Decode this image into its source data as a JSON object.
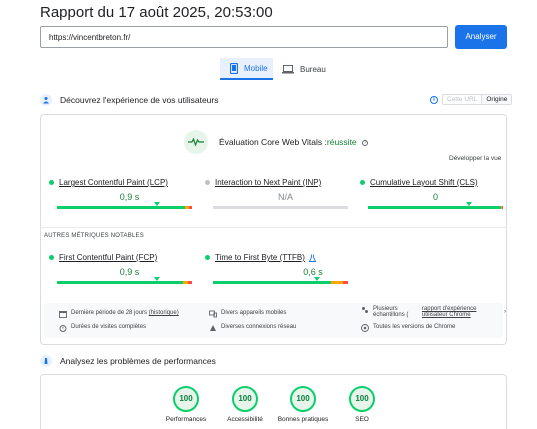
{
  "report": {
    "title": "Rapport du 17 août 2025, 20:53:00"
  },
  "search": {
    "url": "https://vincentbreton.fr/",
    "analyze_label": "Analyser"
  },
  "tabs": {
    "mobile": "Mobile",
    "desktop": "Bureau"
  },
  "user_experience": {
    "heading": "Découvrez l'expérience de vos utilisateurs",
    "toggle_url": "Cette URL",
    "toggle_origin": "Origine",
    "cwv_title": "Évaluation Core Web Vitals :",
    "cwv_status": "réussite",
    "expand_label": "Développer la vue",
    "other_metrics_label": "AUTRES MÉTRIQUES NOTABLES"
  },
  "metrics": {
    "lcp": {
      "label": "Largest Contentful Paint (LCP)",
      "value": "0,9 s",
      "status_color": "#0cce6b"
    },
    "inp": {
      "label": "Interaction to Next Paint (INP)",
      "value": "N/A",
      "status_color": "#bdc1c6"
    },
    "cls": {
      "label": "Cumulative Layout Shift (CLS)",
      "value": "0",
      "status_color": "#0cce6b"
    },
    "fcp": {
      "label": "First Contentful Paint (FCP)",
      "value": "0,9 s",
      "status_color": "#0cce6b"
    },
    "ttfb": {
      "label": "Time to First Byte (TTFB)",
      "value": "0,6 s",
      "status_color": "#0cce6b"
    }
  },
  "footer": {
    "period": "Dernière période de 28 jours",
    "history_link": "(historique)",
    "devices": "Divers appareils mobiles",
    "samples_prefix": "Plusieurs échantillons (",
    "chrome_report_link": "rapport d'expérience utilisateur Chrome",
    "durations": "Durées de visites complètes",
    "network": "Diverses connexions réseau",
    "chrome_versions": "Toutes les versions de Chrome"
  },
  "performance": {
    "heading": "Analysez les problèmes de performances",
    "scores": [
      {
        "label": "Performances",
        "value": "100"
      },
      {
        "label": "Accessibilité",
        "value": "100"
      },
      {
        "label": "Bonnes pratiques",
        "value": "100"
      },
      {
        "label": "SEO",
        "value": "100"
      }
    ]
  },
  "colors": {
    "accent": "#1a73e8",
    "good": "#0cce6b",
    "average": "#ffa400",
    "poor": "#ff4e42"
  }
}
